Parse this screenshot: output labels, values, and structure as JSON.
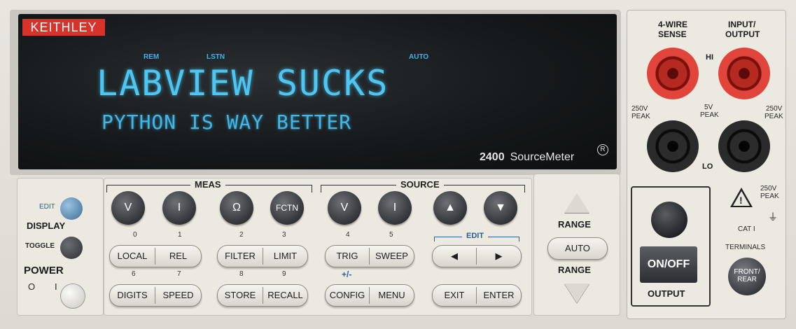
{
  "brand": "KEITHLEY",
  "display": {
    "annunciators": [
      "REM",
      "LSTN",
      "AUTO"
    ],
    "line1": "LABVIEW SUCKS",
    "line2": "PYTHON IS WAY BETTER"
  },
  "model": {
    "number": "2400",
    "name": "SourceMeter",
    "reg": "R"
  },
  "left": {
    "edit_label": "EDIT",
    "display_label": "DISPLAY",
    "toggle_label": "TOGGLE",
    "power_label": "POWER",
    "power_off": "O",
    "power_on": "I"
  },
  "meas": {
    "label": "MEAS",
    "buttons": [
      "V",
      "I",
      "Ω",
      "FCTN"
    ],
    "numbers": [
      "0",
      "1",
      "2",
      "3"
    ]
  },
  "source": {
    "label": "SOURCE",
    "buttons": [
      "V",
      "I",
      "▲",
      "▼"
    ],
    "numbers": [
      "4",
      "5"
    ]
  },
  "edit_group": "EDIT",
  "row2": {
    "local": "LOCAL",
    "rel": "REL",
    "filter": "FILTER",
    "limit": "LIMIT",
    "trig": "TRIG",
    "sweep": "SWEEP",
    "left_arrow": "◀",
    "right_arrow": "▶",
    "numbers": [
      "6",
      "7",
      "8",
      "9"
    ],
    "plusminus": "+/-"
  },
  "row3": {
    "digits": "DIGITS",
    "speed": "SPEED",
    "store": "STORE",
    "recall": "RECALL",
    "config": "CONFIG",
    "menu": "MENU",
    "exit": "EXIT",
    "enter": "ENTER"
  },
  "range": {
    "top": "RANGE",
    "auto": "AUTO",
    "bottom": "RANGE"
  },
  "terminals": {
    "four_wire": "4-WIRE",
    "sense": "SENSE",
    "input": "INPUT/",
    "output": "OUTPUT",
    "hi": "HI",
    "lo": "LO",
    "peak_left_v": "250V",
    "peak_left": "PEAK",
    "mid_v": "5V",
    "mid_peak": "PEAK",
    "peak_right_v": "250V",
    "peak_right": "PEAK",
    "peak_bottom_v": "250V",
    "peak_bottom": "PEAK",
    "cat": "CAT I",
    "terminals_label": "TERMINALS",
    "front": "FRONT/",
    "rear": "REAR",
    "onoff": "ON/OFF",
    "output_label": "OUTPUT"
  },
  "colors": {
    "display_text": "#4cc6f2",
    "brand_red": "#d8322a",
    "edit_blue": "#2d5d9f"
  }
}
